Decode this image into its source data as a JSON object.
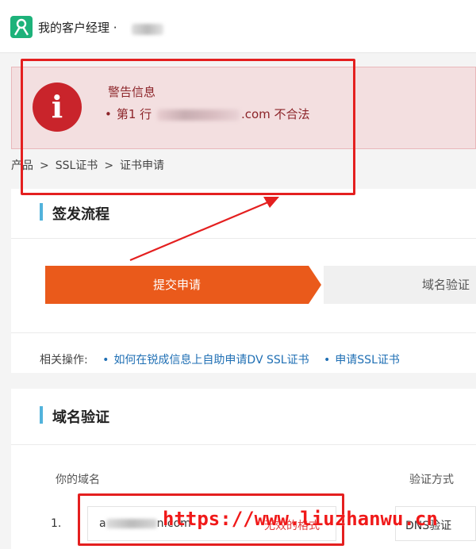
{
  "topbar": {
    "title": "我的客户经理 ·"
  },
  "alert": {
    "icon_char": "i",
    "title": "警告信息",
    "message_prefix": "第1 行",
    "message_suffix": ".com 不合法"
  },
  "breadcrumb": {
    "items": [
      "产品",
      "SSL证书",
      "证书申请"
    ],
    "separator": ">"
  },
  "issue_process": {
    "title": "签发流程",
    "steps": [
      "提交申请",
      "域名验证"
    ],
    "related_label": "相关操作:",
    "related_links": [
      "如何在锐成信息上自助申请DV SSL证书",
      "申请SSL证书"
    ]
  },
  "domain_verify": {
    "title": "域名验证",
    "col_domain": "你的域名",
    "col_method": "验证方式",
    "rows": [
      {
        "index": "1.",
        "domain_prefix": "a",
        "domain_suffix": "n.com",
        "error": "无效的格式",
        "method": "DNS验证"
      }
    ]
  },
  "watermark": "https://www.liuzhanwu.cn",
  "colors": {
    "accent_orange": "#ea5a1b",
    "alert_bg": "#f3dfe0",
    "alert_red": "#c9242b",
    "highlight_box": "#e41f1f",
    "link_blue": "#1f6fb4",
    "section_bar": "#52b3dc"
  }
}
